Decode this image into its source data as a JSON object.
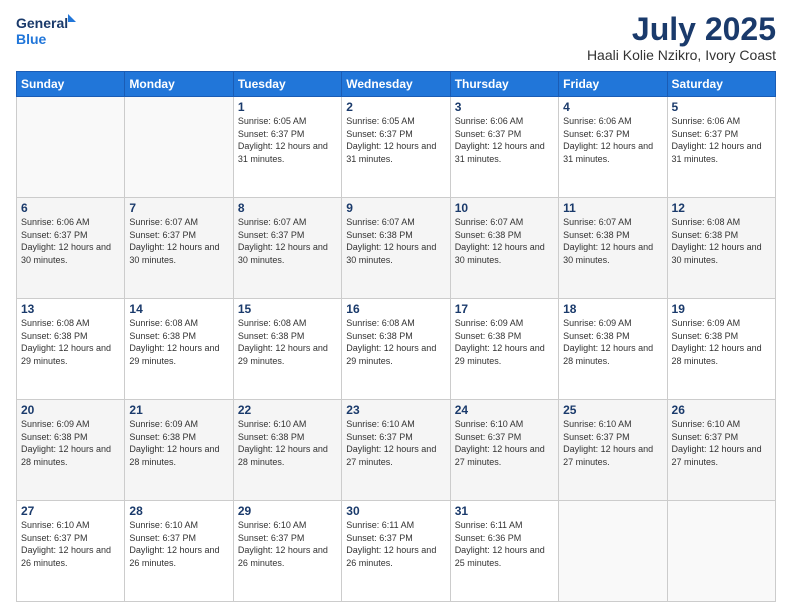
{
  "logo": {
    "line1": "General",
    "line2": "Blue"
  },
  "title": "July 2025",
  "subtitle": "Haali Kolie Nzikro, Ivory Coast",
  "days_of_week": [
    "Sunday",
    "Monday",
    "Tuesday",
    "Wednesday",
    "Thursday",
    "Friday",
    "Saturday"
  ],
  "weeks": [
    [
      {
        "day": "",
        "info": ""
      },
      {
        "day": "",
        "info": ""
      },
      {
        "day": "1",
        "info": "Sunrise: 6:05 AM\nSunset: 6:37 PM\nDaylight: 12 hours and 31 minutes."
      },
      {
        "day": "2",
        "info": "Sunrise: 6:05 AM\nSunset: 6:37 PM\nDaylight: 12 hours and 31 minutes."
      },
      {
        "day": "3",
        "info": "Sunrise: 6:06 AM\nSunset: 6:37 PM\nDaylight: 12 hours and 31 minutes."
      },
      {
        "day": "4",
        "info": "Sunrise: 6:06 AM\nSunset: 6:37 PM\nDaylight: 12 hours and 31 minutes."
      },
      {
        "day": "5",
        "info": "Sunrise: 6:06 AM\nSunset: 6:37 PM\nDaylight: 12 hours and 31 minutes."
      }
    ],
    [
      {
        "day": "6",
        "info": "Sunrise: 6:06 AM\nSunset: 6:37 PM\nDaylight: 12 hours and 30 minutes."
      },
      {
        "day": "7",
        "info": "Sunrise: 6:07 AM\nSunset: 6:37 PM\nDaylight: 12 hours and 30 minutes."
      },
      {
        "day": "8",
        "info": "Sunrise: 6:07 AM\nSunset: 6:37 PM\nDaylight: 12 hours and 30 minutes."
      },
      {
        "day": "9",
        "info": "Sunrise: 6:07 AM\nSunset: 6:38 PM\nDaylight: 12 hours and 30 minutes."
      },
      {
        "day": "10",
        "info": "Sunrise: 6:07 AM\nSunset: 6:38 PM\nDaylight: 12 hours and 30 minutes."
      },
      {
        "day": "11",
        "info": "Sunrise: 6:07 AM\nSunset: 6:38 PM\nDaylight: 12 hours and 30 minutes."
      },
      {
        "day": "12",
        "info": "Sunrise: 6:08 AM\nSunset: 6:38 PM\nDaylight: 12 hours and 30 minutes."
      }
    ],
    [
      {
        "day": "13",
        "info": "Sunrise: 6:08 AM\nSunset: 6:38 PM\nDaylight: 12 hours and 29 minutes."
      },
      {
        "day": "14",
        "info": "Sunrise: 6:08 AM\nSunset: 6:38 PM\nDaylight: 12 hours and 29 minutes."
      },
      {
        "day": "15",
        "info": "Sunrise: 6:08 AM\nSunset: 6:38 PM\nDaylight: 12 hours and 29 minutes."
      },
      {
        "day": "16",
        "info": "Sunrise: 6:08 AM\nSunset: 6:38 PM\nDaylight: 12 hours and 29 minutes."
      },
      {
        "day": "17",
        "info": "Sunrise: 6:09 AM\nSunset: 6:38 PM\nDaylight: 12 hours and 29 minutes."
      },
      {
        "day": "18",
        "info": "Sunrise: 6:09 AM\nSunset: 6:38 PM\nDaylight: 12 hours and 28 minutes."
      },
      {
        "day": "19",
        "info": "Sunrise: 6:09 AM\nSunset: 6:38 PM\nDaylight: 12 hours and 28 minutes."
      }
    ],
    [
      {
        "day": "20",
        "info": "Sunrise: 6:09 AM\nSunset: 6:38 PM\nDaylight: 12 hours and 28 minutes."
      },
      {
        "day": "21",
        "info": "Sunrise: 6:09 AM\nSunset: 6:38 PM\nDaylight: 12 hours and 28 minutes."
      },
      {
        "day": "22",
        "info": "Sunrise: 6:10 AM\nSunset: 6:38 PM\nDaylight: 12 hours and 28 minutes."
      },
      {
        "day": "23",
        "info": "Sunrise: 6:10 AM\nSunset: 6:37 PM\nDaylight: 12 hours and 27 minutes."
      },
      {
        "day": "24",
        "info": "Sunrise: 6:10 AM\nSunset: 6:37 PM\nDaylight: 12 hours and 27 minutes."
      },
      {
        "day": "25",
        "info": "Sunrise: 6:10 AM\nSunset: 6:37 PM\nDaylight: 12 hours and 27 minutes."
      },
      {
        "day": "26",
        "info": "Sunrise: 6:10 AM\nSunset: 6:37 PM\nDaylight: 12 hours and 27 minutes."
      }
    ],
    [
      {
        "day": "27",
        "info": "Sunrise: 6:10 AM\nSunset: 6:37 PM\nDaylight: 12 hours and 26 minutes."
      },
      {
        "day": "28",
        "info": "Sunrise: 6:10 AM\nSunset: 6:37 PM\nDaylight: 12 hours and 26 minutes."
      },
      {
        "day": "29",
        "info": "Sunrise: 6:10 AM\nSunset: 6:37 PM\nDaylight: 12 hours and 26 minutes."
      },
      {
        "day": "30",
        "info": "Sunrise: 6:11 AM\nSunset: 6:37 PM\nDaylight: 12 hours and 26 minutes."
      },
      {
        "day": "31",
        "info": "Sunrise: 6:11 AM\nSunset: 6:36 PM\nDaylight: 12 hours and 25 minutes."
      },
      {
        "day": "",
        "info": ""
      },
      {
        "day": "",
        "info": ""
      }
    ]
  ]
}
